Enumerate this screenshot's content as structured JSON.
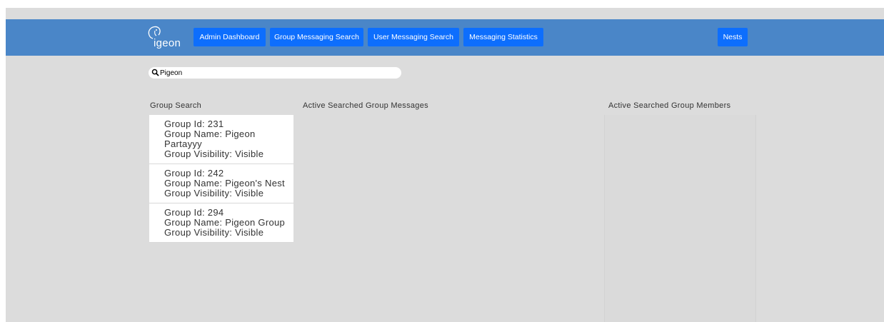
{
  "navbar": {
    "logo_text": "igeon",
    "buttons": [
      "Admin Dashboard",
      "Group Messaging Search",
      "User Messaging Search",
      "Messaging Statistics"
    ],
    "nests_label": "Nests"
  },
  "search": {
    "value": "Pigeon"
  },
  "columns": {
    "group_search": "Group Search",
    "messages": "Active Searched Group Messages",
    "members": "Active Searched Group Members"
  },
  "groups": [
    {
      "id_line": "Group Id: 231",
      "name_line": "Group Name: Pigeon Partayyy",
      "visibility_line": "Group Visibility: Visible"
    },
    {
      "id_line": "Group Id: 242",
      "name_line": "Group Name: Pigeon's Nest",
      "visibility_line": "Group Visibility: Visible"
    },
    {
      "id_line": "Group Id: 294",
      "name_line": "Group Name: Pigeon Group",
      "visibility_line": "Group Visibility: Visible"
    }
  ]
}
